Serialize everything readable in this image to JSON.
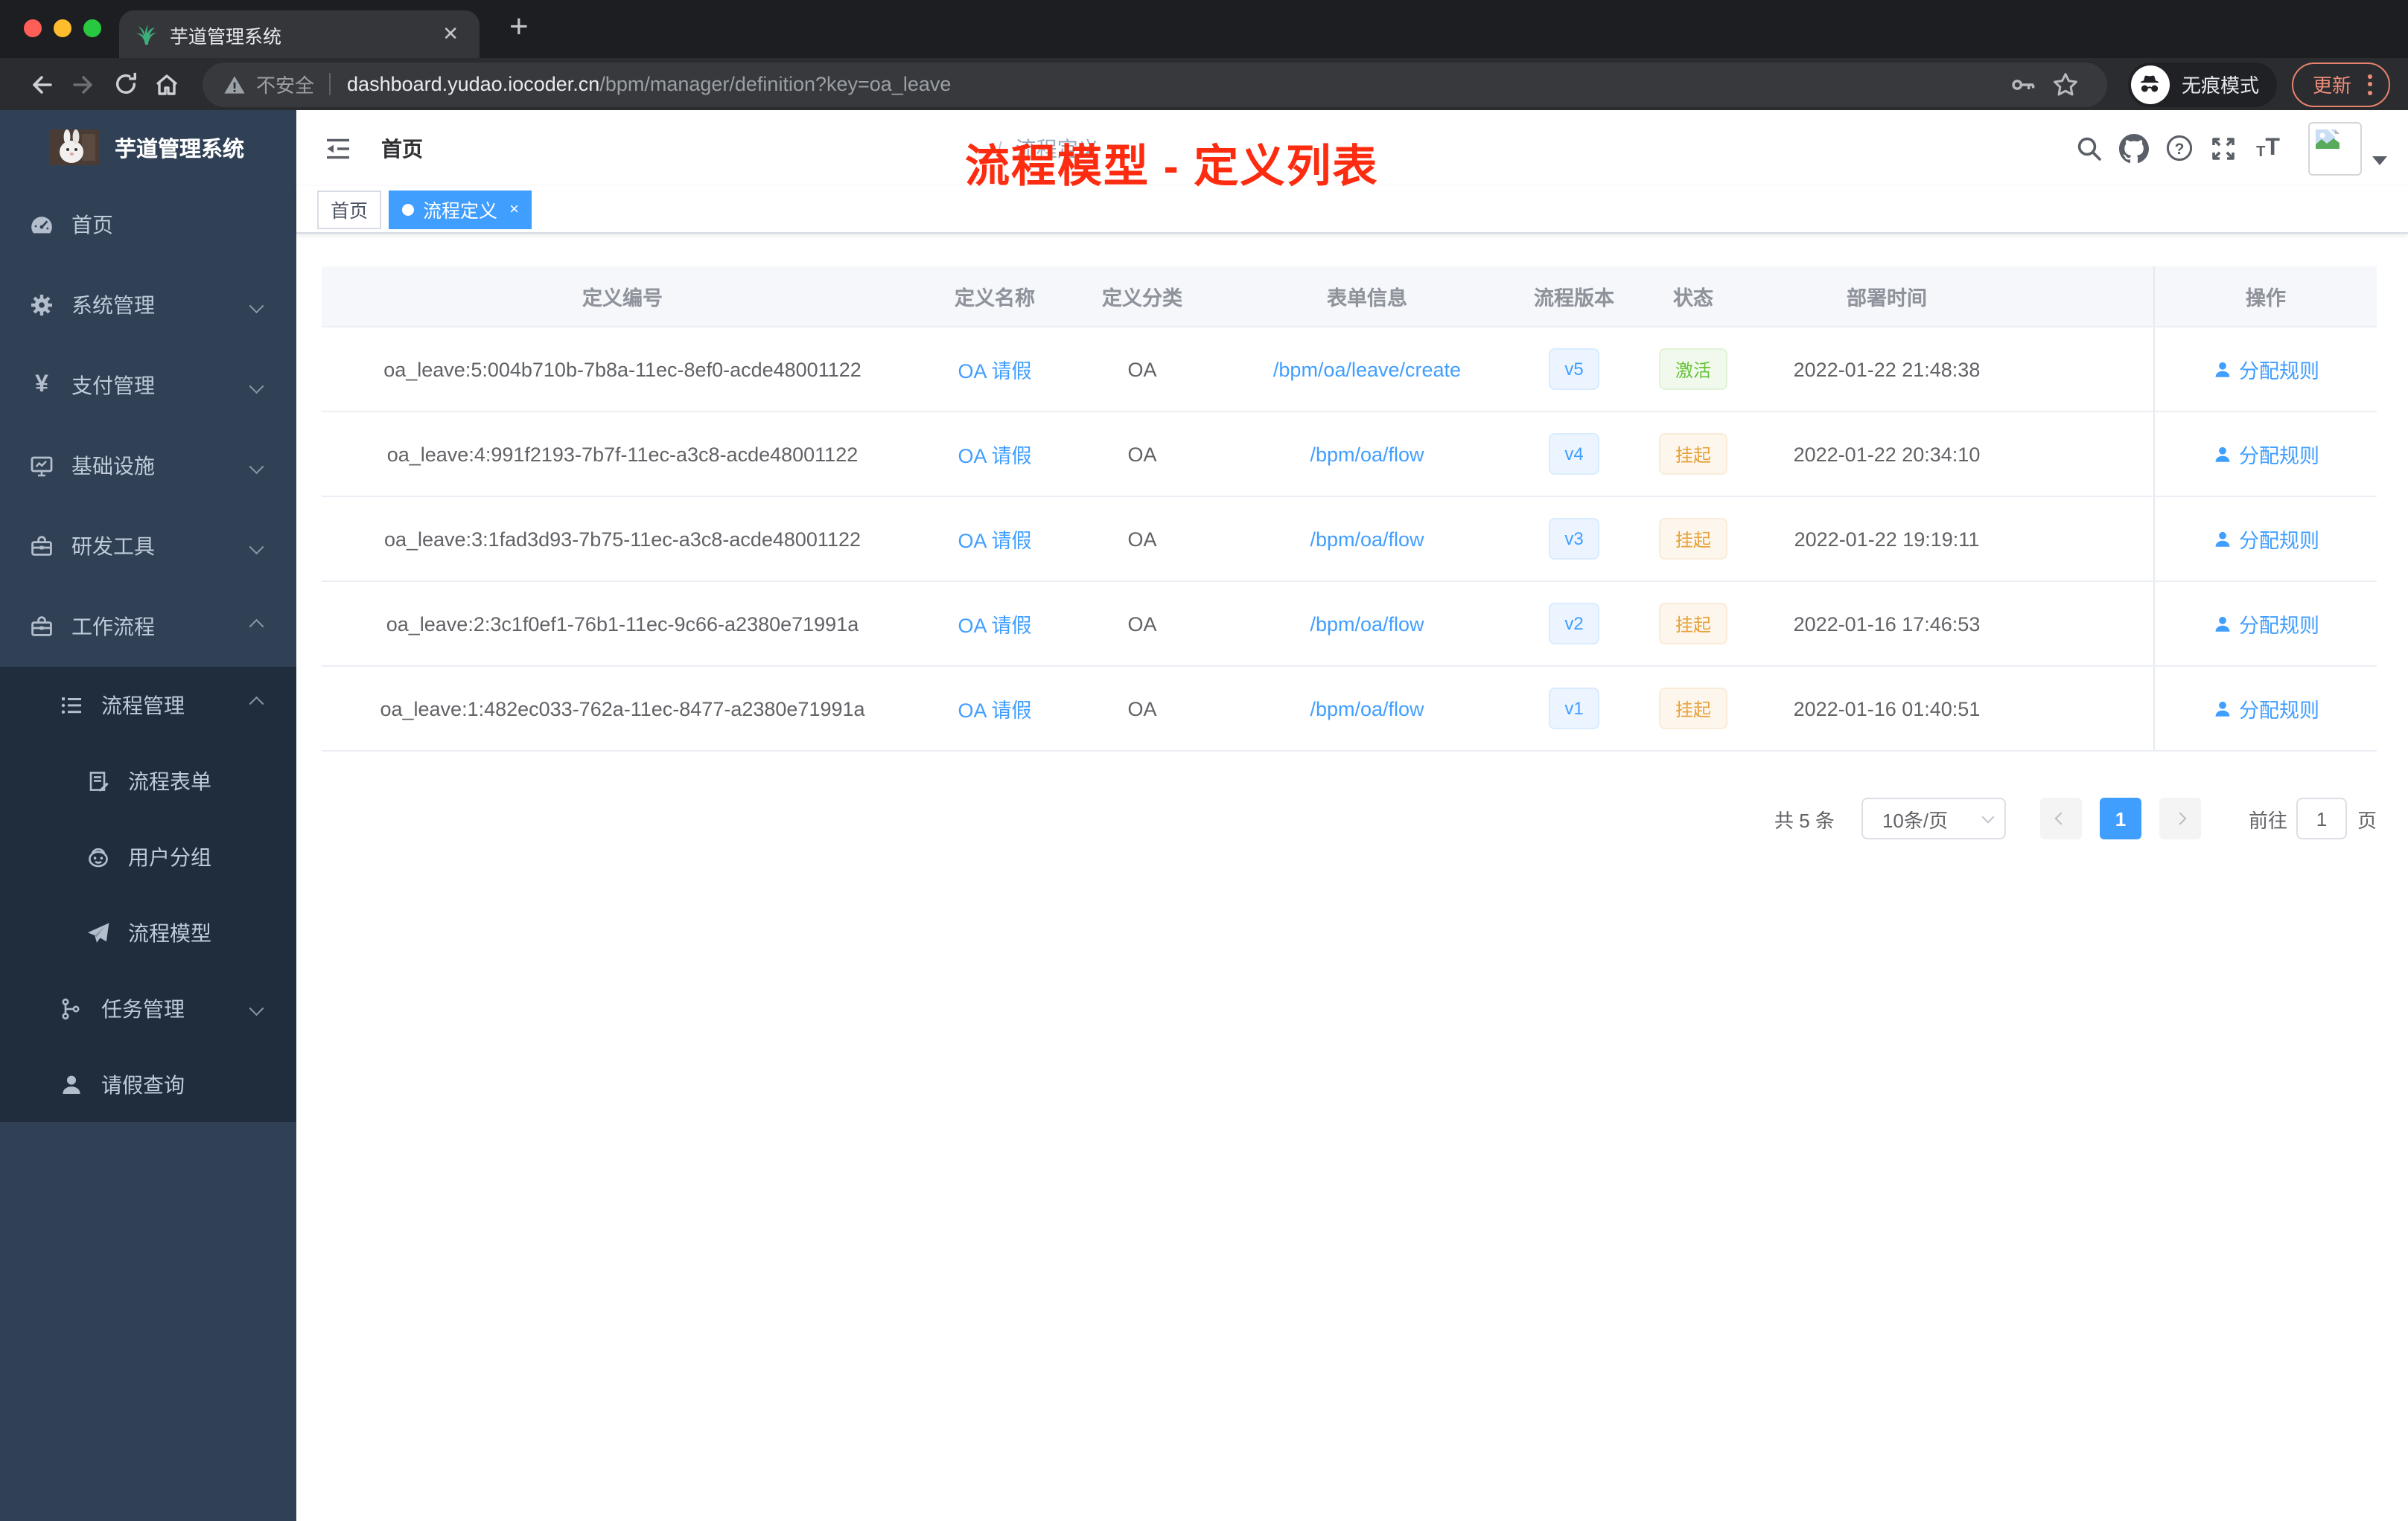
{
  "browser": {
    "tab_title": "芋道管理系统",
    "new_tab": "+",
    "security_label": "不安全",
    "url_domain": "dashboard.yudao.iocoder.cn",
    "url_path": "/bpm/manager/definition?key=oa_leave",
    "incognito_label": "无痕模式",
    "update_label": "更新"
  },
  "sidebar": {
    "logo_title": "芋道管理系统",
    "menu": [
      {
        "label": "首页",
        "icon": "dashboard-icon",
        "level": 1
      },
      {
        "label": "系统管理",
        "icon": "gear-icon",
        "level": 1,
        "chevron": "down"
      },
      {
        "label": "支付管理",
        "icon": "yen-icon",
        "level": 1,
        "chevron": "down"
      },
      {
        "label": "基础设施",
        "icon": "monitor-icon",
        "level": 1,
        "chevron": "down"
      },
      {
        "label": "研发工具",
        "icon": "toolbox-icon",
        "level": 1,
        "chevron": "down"
      },
      {
        "label": "工作流程",
        "icon": "toolbox-icon",
        "level": 1,
        "chevron": "up"
      },
      {
        "label": "流程管理",
        "icon": "list-icon",
        "level": 2,
        "chevron": "up"
      },
      {
        "label": "流程表单",
        "icon": "form-icon",
        "level": 3
      },
      {
        "label": "用户分组",
        "icon": "robot-icon",
        "level": 3
      },
      {
        "label": "流程模型",
        "icon": "send-icon",
        "level": 3
      },
      {
        "label": "任务管理",
        "icon": "tree-icon",
        "level": 2,
        "chevron": "down"
      },
      {
        "label": "请假查询",
        "icon": "user-icon",
        "level": 2
      }
    ]
  },
  "header": {
    "breadcrumb": [
      "首页",
      "流程定义"
    ],
    "breadcrumb_separator": "/",
    "annotation": "流程模型 - 定义列表"
  },
  "tags": {
    "items": [
      {
        "label": "首页",
        "active": false
      },
      {
        "label": "流程定义",
        "active": true,
        "close": "×"
      }
    ]
  },
  "table": {
    "columns": [
      "定义编号",
      "定义名称",
      "定义分类",
      "表单信息",
      "流程版本",
      "状态",
      "部署时间",
      "操作"
    ],
    "rows": [
      {
        "id": "oa_leave:5:004b710b-7b8a-11ec-8ef0-acde48001122",
        "name": "OA 请假",
        "category": "OA",
        "form": "/bpm/oa/leave/create",
        "version": "v5",
        "status": "激活",
        "status_type": "success",
        "time": "2022-01-22 21:48:38",
        "action": "分配规则"
      },
      {
        "id": "oa_leave:4:991f2193-7b7f-11ec-a3c8-acde48001122",
        "name": "OA 请假",
        "category": "OA",
        "form": "/bpm/oa/flow",
        "version": "v4",
        "status": "挂起",
        "status_type": "warning",
        "time": "2022-01-22 20:34:10",
        "action": "分配规则"
      },
      {
        "id": "oa_leave:3:1fad3d93-7b75-11ec-a3c8-acde48001122",
        "name": "OA 请假",
        "category": "OA",
        "form": "/bpm/oa/flow",
        "version": "v3",
        "status": "挂起",
        "status_type": "warning",
        "time": "2022-01-22 19:19:11",
        "action": "分配规则"
      },
      {
        "id": "oa_leave:2:3c1f0ef1-76b1-11ec-9c66-a2380e71991a",
        "name": "OA 请假",
        "category": "OA",
        "form": "/bpm/oa/flow",
        "version": "v2",
        "status": "挂起",
        "status_type": "warning",
        "time": "2022-01-16 17:46:53",
        "action": "分配规则"
      },
      {
        "id": "oa_leave:1:482ec033-762a-11ec-8477-a2380e71991a",
        "name": "OA 请假",
        "category": "OA",
        "form": "/bpm/oa/flow",
        "version": "v1",
        "status": "挂起",
        "status_type": "warning",
        "time": "2022-01-16 01:40:51",
        "action": "分配规则"
      }
    ]
  },
  "pagination": {
    "total_label": "共 5 条",
    "page_size": "10条/页",
    "current_page": "1",
    "goto_label": "前往",
    "goto_value": "1",
    "page_unit": "页"
  },
  "colors": {
    "accent": "#409eff",
    "annotation_red": "#fd2b10",
    "sidebar_bg": "#304156",
    "submenu_bg": "#1f2d3d",
    "success": "#67c23a",
    "warning": "#e6a23c",
    "tag_primary_bg": "#ecf5ff",
    "tag_success_bg": "#f0f9eb",
    "tag_warning_bg": "#fdf6ec"
  }
}
